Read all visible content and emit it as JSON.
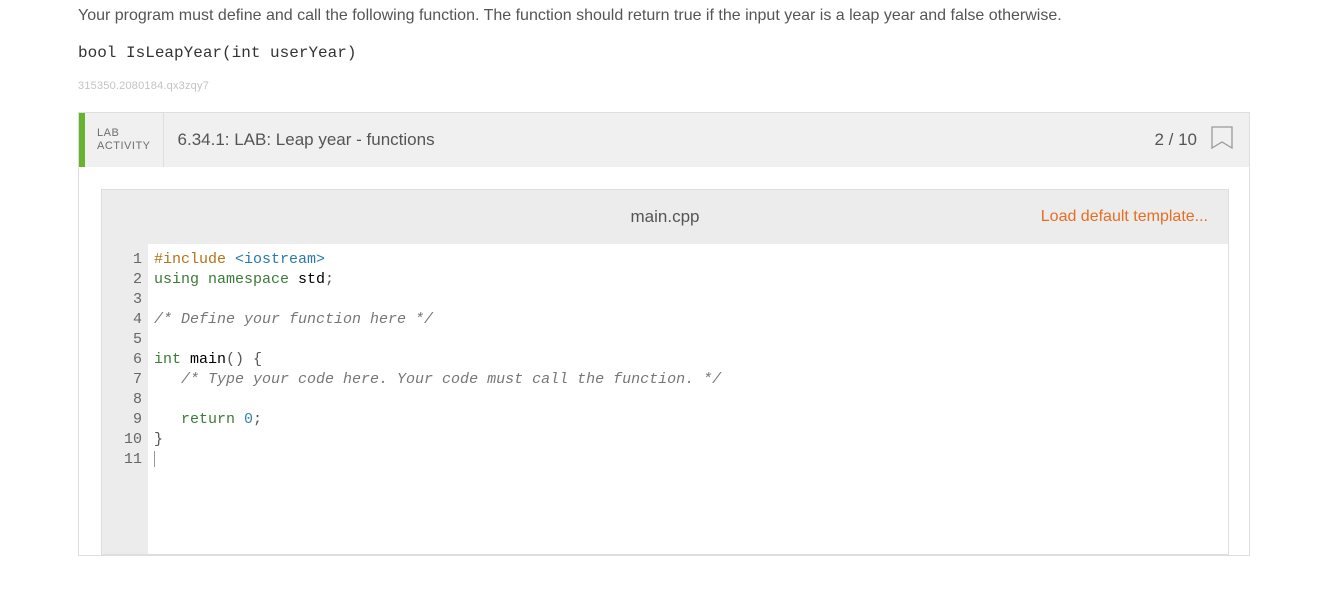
{
  "intro": {
    "text": "Your program must define and call the following function. The function should return true if the input year is a leap year and false otherwise.",
    "signature": "bool IsLeapYear(int userYear)"
  },
  "trace_id": "315350.2080184.qx3zqy7",
  "lab": {
    "chip_line1": "LAB",
    "chip_line2": "ACTIVITY",
    "title": "6.34.1: LAB: Leap year - functions",
    "score": "2 / 10"
  },
  "editor": {
    "filename": "main.cpp",
    "load_link": "Load default template...",
    "lines": [
      {
        "n": "1",
        "tokens": [
          {
            "t": "#include ",
            "c": "pre"
          },
          {
            "t": "<iostream>",
            "c": "str"
          }
        ]
      },
      {
        "n": "2",
        "tokens": [
          {
            "t": "using ",
            "c": "kw"
          },
          {
            "t": "namespace ",
            "c": "kw"
          },
          {
            "t": "std",
            "c": "id"
          },
          {
            "t": ";",
            "c": "pun"
          }
        ]
      },
      {
        "n": "3",
        "tokens": []
      },
      {
        "n": "4",
        "tokens": [
          {
            "t": "/* Define your function here */",
            "c": "cmt"
          }
        ]
      },
      {
        "n": "5",
        "tokens": []
      },
      {
        "n": "6",
        "tokens": [
          {
            "t": "int ",
            "c": "type"
          },
          {
            "t": "main",
            "c": "id"
          },
          {
            "t": "()",
            "c": "pun"
          },
          {
            "t": " {",
            "c": "pun"
          }
        ]
      },
      {
        "n": "7",
        "tokens": [
          {
            "t": "   ",
            "c": "pun"
          },
          {
            "t": "/* Type your code here. Your code must call the function. */",
            "c": "cmt"
          }
        ]
      },
      {
        "n": "8",
        "tokens": []
      },
      {
        "n": "9",
        "tokens": [
          {
            "t": "   ",
            "c": "pun"
          },
          {
            "t": "return ",
            "c": "kw"
          },
          {
            "t": "0",
            "c": "num"
          },
          {
            "t": ";",
            "c": "pun"
          }
        ]
      },
      {
        "n": "10",
        "tokens": [
          {
            "t": "}",
            "c": "pun"
          }
        ]
      },
      {
        "n": "11",
        "tokens": [],
        "cursor": true
      }
    ]
  }
}
